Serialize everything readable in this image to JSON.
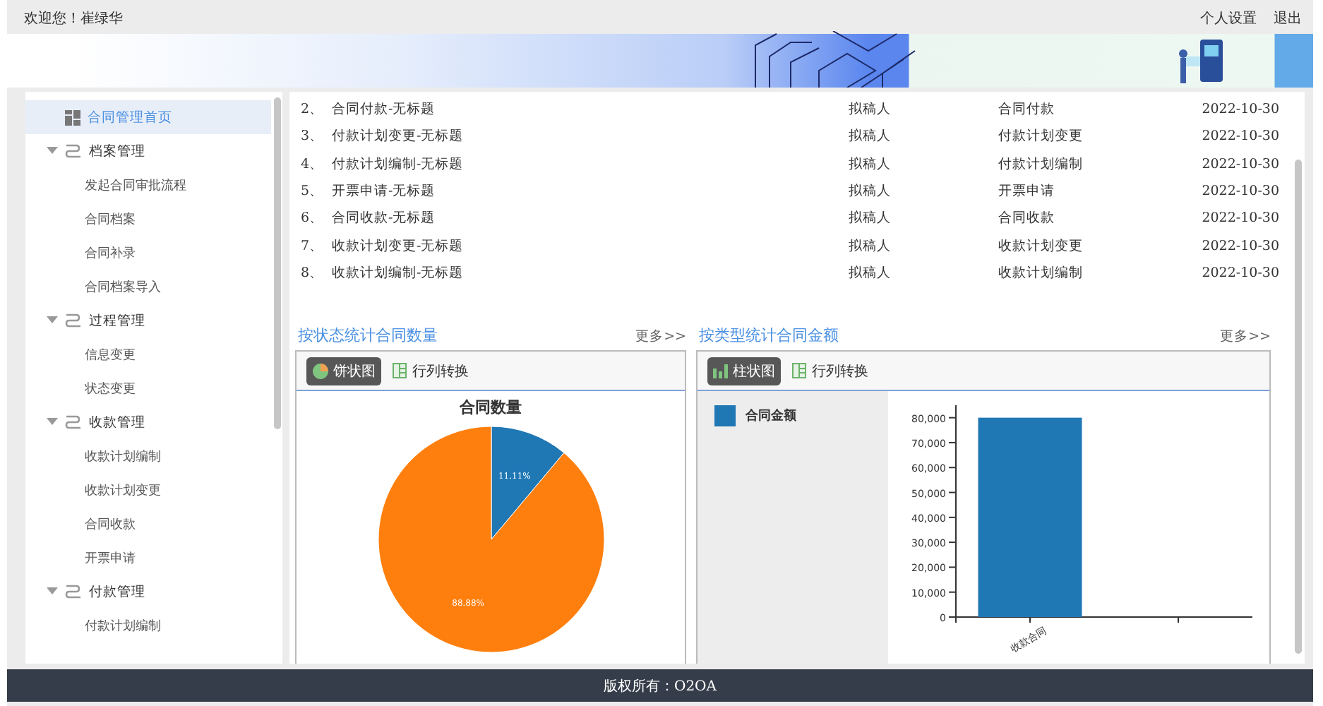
{
  "top_bar": {
    "welcome": "欢迎您！崔绿华",
    "links": [
      "个人设置",
      "退出"
    ]
  },
  "sidebar": {
    "items": [
      {
        "label": "合同管理首页",
        "kind": "page",
        "selected": true
      },
      {
        "label": "档案管理",
        "kind": "group",
        "selected": false,
        "expanded": true,
        "children": [
          {
            "label": "发起合同审批流程",
            "selected": false
          },
          {
            "label": "合同档案",
            "selected": false
          },
          {
            "label": "合同补录",
            "selected": false
          },
          {
            "label": "合同档案导入",
            "selected": false
          }
        ]
      },
      {
        "label": "过程管理",
        "kind": "group",
        "selected": false,
        "expanded": true,
        "children": [
          {
            "label": "信息变更",
            "selected": false
          },
          {
            "label": "状态变更",
            "selected": false
          }
        ]
      },
      {
        "label": "收款管理",
        "kind": "group",
        "selected": false,
        "expanded": true,
        "children": [
          {
            "label": "收款计划编制",
            "selected": false
          },
          {
            "label": "收款计划变更",
            "selected": false
          },
          {
            "label": "合同收款",
            "selected": false
          },
          {
            "label": "开票申请",
            "selected": false
          }
        ]
      },
      {
        "label": "付款管理",
        "kind": "group",
        "selected": false,
        "expanded": true,
        "children": [
          {
            "label": "付款计划编制",
            "selected": false
          }
        ]
      }
    ]
  },
  "task_list": {
    "rows": [
      {
        "index": "2、",
        "title": "合同付款-无标题",
        "role": "拟稿人",
        "type": "合同付款",
        "date": "2022-10-30"
      },
      {
        "index": "3、",
        "title": "付款计划变更-无标题",
        "role": "拟稿人",
        "type": "付款计划变更",
        "date": "2022-10-30"
      },
      {
        "index": "4、",
        "title": "付款计划编制-无标题",
        "role": "拟稿人",
        "type": "付款计划编制",
        "date": "2022-10-30"
      },
      {
        "index": "5、",
        "title": "开票申请-无标题",
        "role": "拟稿人",
        "type": "开票申请",
        "date": "2022-10-30"
      },
      {
        "index": "6、",
        "title": "合同收款-无标题",
        "role": "拟稿人",
        "type": "合同收款",
        "date": "2022-10-30"
      },
      {
        "index": "7、",
        "title": "收款计划变更-无标题",
        "role": "拟稿人",
        "type": "收款计划变更",
        "date": "2022-10-30"
      },
      {
        "index": "8、",
        "title": "收款计划编制-无标题",
        "role": "拟稿人",
        "type": "收款计划编制",
        "date": "2022-10-30"
      }
    ]
  },
  "panels": [
    {
      "title": "按状态统计合同数量",
      "more": "更多>>",
      "chart_button": "饼状图",
      "toggle_button": "行列转换",
      "chart_data": {
        "type": "pie",
        "title": "合同数量",
        "series": [
          {
            "values": [
              11.11,
              88.88
            ]
          }
        ],
        "colors": [
          "#1f77b4",
          "#ff7f0e"
        ],
        "value_labels": [
          "11.11%",
          "88.88%"
        ]
      }
    },
    {
      "title": "按类型统计合同金额",
      "more": "更多>>",
      "chart_button": "柱状图",
      "toggle_button": "行列转换",
      "chart_data": {
        "type": "bar",
        "categories": [
          "收款合同",
          null
        ],
        "series": [
          {
            "name": "合同金额",
            "color": "#1f77b4",
            "values": [
              80000,
              null
            ]
          }
        ],
        "ylim": [
          0,
          85000
        ],
        "yticks": [
          {
            "value": 0,
            "label": "0"
          },
          {
            "value": 10000,
            "label": "10,000"
          },
          {
            "value": 20000,
            "label": "20,000"
          },
          {
            "value": 30000,
            "label": "30,000"
          },
          {
            "value": 40000,
            "label": "40,000"
          },
          {
            "value": 50000,
            "label": "50,000"
          },
          {
            "value": 60000,
            "label": "60,000"
          },
          {
            "value": 70000,
            "label": "70,000"
          },
          {
            "value": 80000,
            "label": "80,000"
          }
        ]
      }
    }
  ],
  "footer": "版权所有：O2OA"
}
